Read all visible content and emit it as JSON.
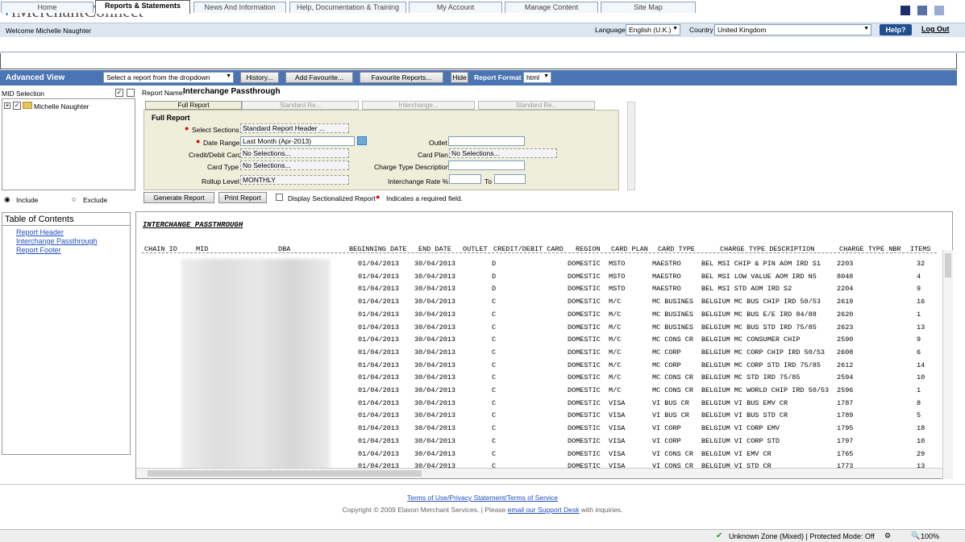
{
  "header": {
    "logo_text": "iMerchantConnect",
    "welcome": "Welcome Michelle Naughter",
    "language_label": "Language",
    "language_value": "English (U.K.)",
    "country_label": "Country",
    "country_value": "United Kingdom",
    "help": "Help?",
    "logout": "Log Out"
  },
  "tabs": [
    "Home",
    "Reports & Statements",
    "News And Information",
    "Help, Documentation & Training",
    "My Account",
    "Manage Content",
    "Site Map"
  ],
  "advanced": {
    "title": "Advanced View",
    "report_select": "Select a report from the dropdown",
    "history": "History...",
    "add_favourite": "Add Favourite...",
    "favourite_reports": "Favourite Reports...",
    "hide": "Hide",
    "format_label": "Report Format",
    "format_value": "html"
  },
  "mid": {
    "title": "MID Selection",
    "tree_item": "Michelle Naughter",
    "include": "Include",
    "exclude": "Exclude"
  },
  "report_name_label": "Report Name:",
  "report_name": "Interchange Passthrough",
  "filter_tabs": [
    "Full Report",
    "Standard Re...",
    "Interchange...",
    "Standard Re..."
  ],
  "filter": {
    "heading": "Full Report",
    "select_sections_label": "Select Sections",
    "select_sections_value": "Standard Report Header ...",
    "date_range_label": "Date Range",
    "date_range_value": "Last Month (Apr-2013)",
    "credit_debit_label": "Credit/Debit Card",
    "credit_debit_value": "No Selections...",
    "card_type_label": "Card Type",
    "card_type_value": "No Selections...",
    "rollup_label": "Rollup Level",
    "rollup_value": "MONTHLY",
    "outlet_label": "Outlet",
    "card_plan_label": "Card Plan",
    "card_plan_value": "No Selections...",
    "charge_type_label": "Charge Type Description",
    "interchange_rate_label": "Interchange Rate %",
    "to_label": "To"
  },
  "actions": {
    "generate": "Generate Report",
    "print": "Print Report",
    "display_sectionalized": "Display Sectionalized Report",
    "required_note": "Indicates a required field."
  },
  "toc": {
    "title": "Table of Contents",
    "links": [
      "Report Header",
      "Interchange Passthrough",
      "Report Footer"
    ]
  },
  "report": {
    "section_title": "INTERCHANGE PASSTHROUGH",
    "columns": [
      "CHAIN ID",
      "MID",
      "DBA",
      "BEGINNING DATE",
      "END DATE",
      "OUTLET",
      "CREDIT/DEBIT CARD",
      "REGION",
      "CARD PLAN",
      "CARD TYPE",
      "CHARGE TYPE DESCRIPTION",
      "CHARGE TYPE NBR",
      "ITEMS"
    ],
    "rows": [
      [
        "01/04/2013",
        "30/04/2013",
        "D",
        "DOMESTIC",
        "MSTO",
        "MAESTRO",
        "BEL MSI CHIP & PIN AOM IRD S1",
        "2203",
        "32"
      ],
      [
        "01/04/2013",
        "30/04/2013",
        "D",
        "DOMESTIC",
        "MSTO",
        "MAESTRO",
        "BEL MSI LOW VALUE AOM IRD N5",
        "8048",
        "4"
      ],
      [
        "01/04/2013",
        "30/04/2013",
        "D",
        "DOMESTIC",
        "MSTO",
        "MAESTRO",
        "BEL MSI STD AOM IRD S2",
        "2204",
        "9"
      ],
      [
        "01/04/2013",
        "30/04/2013",
        "C",
        "DOMESTIC",
        "M/C",
        "MC BUSINES",
        "BELGIUM MC BUS CHIP IRD 50/53",
        "2619",
        "16"
      ],
      [
        "01/04/2013",
        "30/04/2013",
        "C",
        "DOMESTIC",
        "M/C",
        "MC BUSINES",
        "BELGIUM MC BUS E/E IRD 84/88",
        "2620",
        "1"
      ],
      [
        "01/04/2013",
        "30/04/2013",
        "C",
        "DOMESTIC",
        "M/C",
        "MC BUSINES",
        "BELGIUM MC BUS STD IRD 75/85",
        "2623",
        "13"
      ],
      [
        "01/04/2013",
        "30/04/2013",
        "C",
        "DOMESTIC",
        "M/C",
        "MC CONS CR",
        "BELGIUM MC CONSUMER CHIP",
        "2590",
        "9"
      ],
      [
        "01/04/2013",
        "30/04/2013",
        "C",
        "DOMESTIC",
        "M/C",
        "MC CORP",
        "BELGIUM MC CORP CHIP IRD 50/53",
        "2608",
        "6"
      ],
      [
        "01/04/2013",
        "30/04/2013",
        "C",
        "DOMESTIC",
        "M/C",
        "MC CORP",
        "BELGIUM MC CORP STD IRD 75/85",
        "2612",
        "14"
      ],
      [
        "01/04/2013",
        "30/04/2013",
        "C",
        "DOMESTIC",
        "M/C",
        "MC CONS CR",
        "BELGIUM MC STD IRD 75/85",
        "2594",
        "10"
      ],
      [
        "01/04/2013",
        "30/04/2013",
        "C",
        "DOMESTIC",
        "M/C",
        "MC CONS CR",
        "BELGIUM MC WORLD CHIP IRD 50/53",
        "2596",
        "1"
      ],
      [
        "01/04/2013",
        "30/04/2013",
        "C",
        "DOMESTIC",
        "VISA",
        "VI BUS CR",
        "BELGIUM VI BUS EMV CR",
        "1787",
        "8"
      ],
      [
        "01/04/2013",
        "30/04/2013",
        "C",
        "DOMESTIC",
        "VISA",
        "VI BUS CR",
        "BELGIUM VI BUS STD CR",
        "1789",
        "5"
      ],
      [
        "01/04/2013",
        "30/04/2013",
        "C",
        "DOMESTIC",
        "VISA",
        "VI CORP",
        "BELGIUM VI CORP EMV",
        "1795",
        "18"
      ],
      [
        "01/04/2013",
        "30/04/2013",
        "C",
        "DOMESTIC",
        "VISA",
        "VI CORP",
        "BELGIUM VI CORP STD",
        "1797",
        "10"
      ],
      [
        "01/04/2013",
        "30/04/2013",
        "C",
        "DOMESTIC",
        "VISA",
        "VI CONS CR",
        "BELGIUM VI EMV CR",
        "1765",
        "29"
      ],
      [
        "01/04/2013",
        "30/04/2013",
        "C",
        "DOMESTIC",
        "VISA",
        "VI CONS CR",
        "BELGIUM VI STD CR",
        "1773",
        "13"
      ]
    ]
  },
  "footer": {
    "terms": "Terms of Use/Privacy Statement/Terms of Service",
    "copyright": "Copyright © 2009 Elavon Merchant Services.   |   Please",
    "email_link": "email our Support Desk",
    "inquiries": "with inquiries."
  },
  "statusbar": {
    "zone": "Unknown Zone (Mixed) | Protected Mode: Off",
    "zoom": "100%"
  },
  "colors": {
    "accent": "#4a74b3",
    "brand_dark": "#1f4f8f",
    "link": "#1f4fbf",
    "panel": "#efeedb"
  }
}
